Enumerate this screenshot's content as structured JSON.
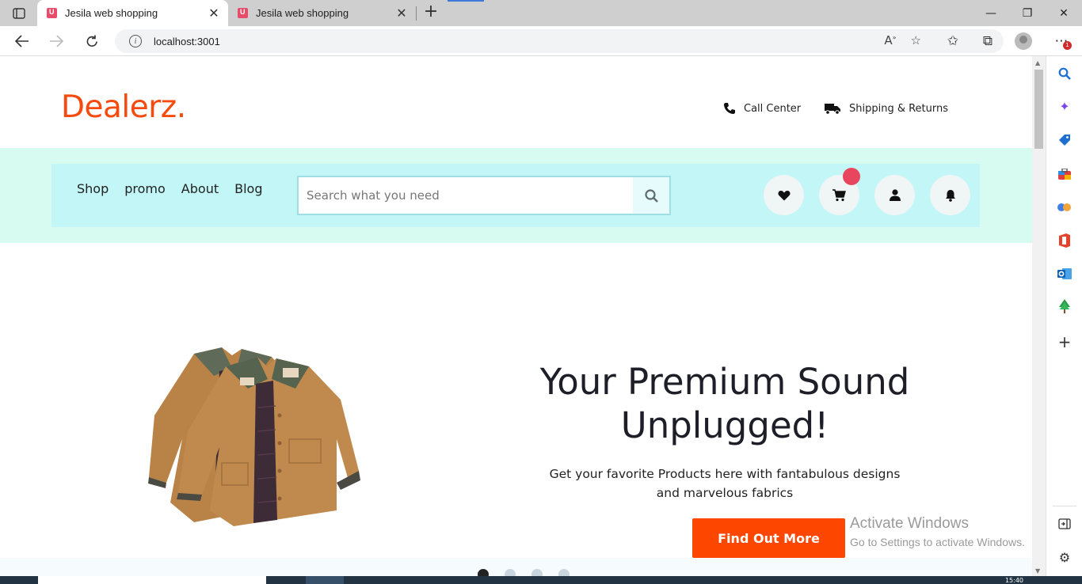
{
  "browser": {
    "tabs": [
      {
        "title": "Jesila web shopping",
        "active": true
      },
      {
        "title": "Jesila web shopping",
        "active": false
      }
    ],
    "url": "localhost:3001"
  },
  "site": {
    "logo": "Dealerz.",
    "top_links": {
      "call_center": "Call Center",
      "shipping": "Shipping & Returns"
    },
    "menu": [
      "Shop",
      "promo",
      "About",
      "Blog"
    ],
    "search_placeholder": "Search what you need"
  },
  "hero": {
    "title_line1": "Your Premium Sound",
    "title_line2": "Unplugged!",
    "subtitle_line1": "Get your favorite Products here with fantabulous designs",
    "subtitle_line2": "and marvelous fabrics",
    "cta": "Find Out More"
  },
  "watermark": {
    "line1": "Activate Windows",
    "line2": "Go to Settings to activate Windows."
  },
  "taskbar": {
    "clock": "15:40"
  },
  "colors": {
    "brand": "#f54b0f",
    "cta": "#fd4600",
    "nav_band": "#d7fbf0",
    "nav_box": "#c3f6f7",
    "badge": "#e8455e"
  },
  "icons": [
    "tab-actions-icon",
    "favicon-icon",
    "close-icon",
    "new-tab-icon",
    "minimize-icon",
    "maximize-icon",
    "window-close-icon",
    "back-icon",
    "forward-icon",
    "refresh-icon",
    "info-icon",
    "read-aloud-icon",
    "add-favorite-icon",
    "favorites-icon",
    "collections-icon",
    "profile-icon",
    "more-icon",
    "phone-icon",
    "truck-icon",
    "search-icon",
    "heart-icon",
    "cart-icon",
    "user-icon",
    "bell-icon"
  ]
}
